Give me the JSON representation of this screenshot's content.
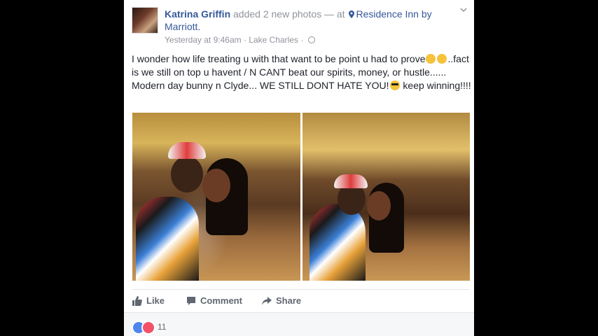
{
  "post": {
    "author": "Katrina Griffin",
    "action_text": " added 2 new photos — at ",
    "location": "Residence Inn by Marriott.",
    "timestamp": "Yesterday at 9:46am",
    "separator": " · ",
    "city": "Lake Charles",
    "text_part1": "I wonder how life treating u with that want to be point u had to prove",
    "text_part2": "..fact is we still on top u havent / N CANT beat our spirits, money, or hustle...... Modern day bunny n Clyde... WE STILL DONT HATE YOU!",
    "text_part3": " keep winning!!!!"
  },
  "actions": {
    "like": "Like",
    "comment": "Comment",
    "share": "Share"
  },
  "reactions": {
    "count": "11"
  },
  "colors": {
    "link": "#365899",
    "meta": "#90949c",
    "like_blue": "#4e86ed",
    "love_red": "#f25268"
  }
}
